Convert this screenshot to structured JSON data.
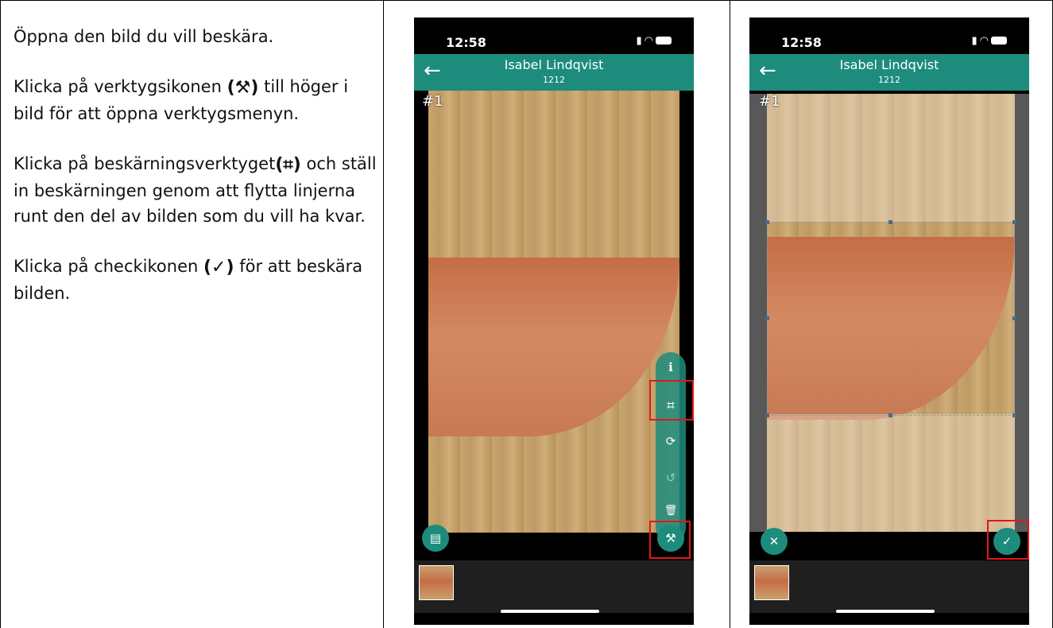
{
  "instructions": {
    "p1": "Öppna den bild du vill beskära.",
    "p2_before": "Klicka på verktygsikonen ",
    "p2_icon": "(⚒)",
    "p2_after": " till höger i bild för att öppna verktygsmenyn.",
    "p3_before": "Klicka på beskärningsverktyget",
    "p3_icon": "(⌗)",
    "p3_after": " och ställ in beskärningen genom att flytta linjerna runt den del av bilden som du vill ha kvar.",
    "p4_before": "Klicka på checkikonen ",
    "p4_icon": "(✓)",
    "p4_after": " för att beskära bilden."
  },
  "phone1": {
    "time": "12:58",
    "app_title": "Isabel Lindqvist",
    "app_subtitle": "1212",
    "photo_label": "#1",
    "icons": {
      "back": "←",
      "info": "ℹ",
      "crop": "⌗",
      "rotate": "⟳",
      "history": "↺",
      "delete": "🗑",
      "tools": "⚒",
      "comment": "▤"
    }
  },
  "phone2": {
    "time": "12:58",
    "app_title": "Isabel Lindqvist",
    "app_subtitle": "1212",
    "photo_label": "#1",
    "icons": {
      "back": "←",
      "cancel": "✕",
      "confirm": "✓"
    }
  },
  "colors": {
    "accent": "#1d8c7d",
    "highlight": "#e3161d"
  }
}
